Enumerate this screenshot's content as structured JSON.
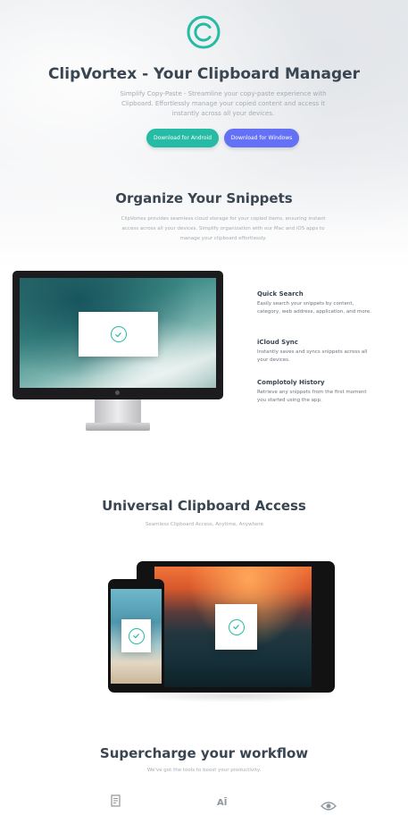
{
  "colors": {
    "accent_teal": "#26bba4",
    "accent_blue": "#6470f5",
    "heading": "#3a4552",
    "muted": "#a5abb2"
  },
  "hero": {
    "logo_icon": "c-copyright-logo-icon",
    "title": "ClipVortex - Your Clipboard Manager",
    "description": "Simplify Copy-Paste - Streamline your copy-paste experience with Clipboard. Effortlessly manage your copied content and access it instantly across all your devices.",
    "buttons": {
      "android": "Download for Android",
      "windows": "Download for Windows"
    }
  },
  "organize": {
    "title": "Organize Your Snippets",
    "description": "ClipVortex provides seamless cloud storage for your copied items, ensuring instant access across all your devices. Simplify organization with our Mac and iOS apps to manage your clipboard effortlessly.",
    "features": [
      {
        "title": "Quick Search",
        "text": "Easily search your snippets by content, category, web address, application, and more."
      },
      {
        "title": "iCloud Sync",
        "text": "Instantly saves and syncs snippets across all your devices."
      },
      {
        "title": "Complotoly History",
        "text": "Retrieve any snippets from the first moment you started using the app."
      }
    ]
  },
  "access": {
    "title": "Universal Clipboard Access",
    "subtitle": "Seamless Clipboard Access, Anytime, Anywhere"
  },
  "workflow": {
    "title": "Supercharge your workflow",
    "subtitle": "We've got the tools to boost your productivity.",
    "icons": [
      "document-icon",
      "text-cursor-icon",
      "eye-icon"
    ],
    "icon_text_middle": "AĪ"
  }
}
